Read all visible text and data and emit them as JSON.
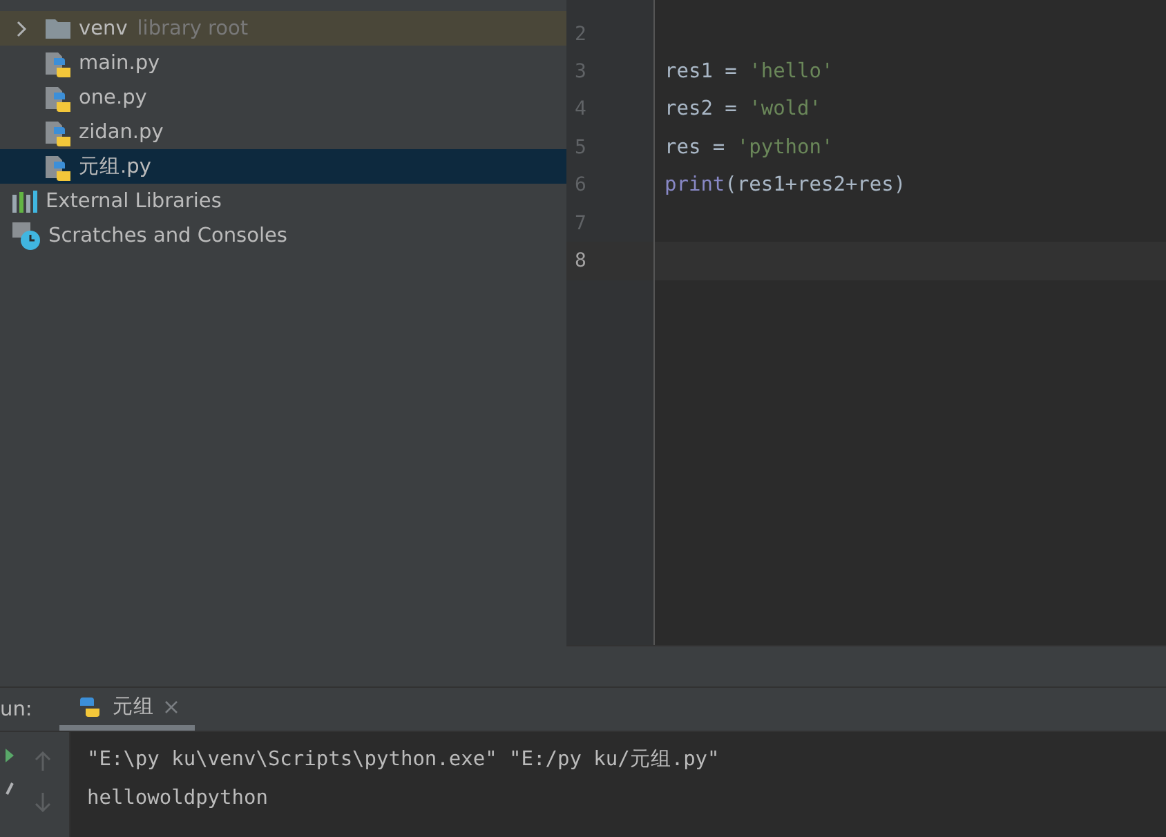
{
  "project_tree": {
    "items": [
      {
        "kind": "folder",
        "label": "venv",
        "hint": "library root",
        "expanded": false,
        "selected": false
      },
      {
        "kind": "python-file",
        "label": "main.py",
        "selected": false
      },
      {
        "kind": "python-file",
        "label": "one.py",
        "selected": false
      },
      {
        "kind": "python-file",
        "label": "zidan.py",
        "selected": false
      },
      {
        "kind": "python-file",
        "label": "元组.py",
        "selected": true
      },
      {
        "kind": "libraries",
        "label": "External Libraries",
        "selected": false
      },
      {
        "kind": "scratches",
        "label": "Scratches and Consoles",
        "selected": false
      }
    ]
  },
  "editor": {
    "lines": [
      {
        "number": "2",
        "current": false
      },
      {
        "number": "3",
        "current": false,
        "tokens": [
          {
            "kind": "name",
            "text": "res1 = "
          },
          {
            "kind": "string",
            "text": "'hello'"
          }
        ]
      },
      {
        "number": "4",
        "current": false,
        "tokens": [
          {
            "kind": "name",
            "text": "res2 = "
          },
          {
            "kind": "string",
            "text": "'wold'"
          }
        ]
      },
      {
        "number": "5",
        "current": false,
        "tokens": [
          {
            "kind": "name",
            "text": "res = "
          },
          {
            "kind": "string",
            "text": "'python'"
          }
        ]
      },
      {
        "number": "6",
        "current": false,
        "tokens": [
          {
            "kind": "builtin",
            "text": "print"
          },
          {
            "kind": "name",
            "text": "(res1+res2+res)"
          }
        ]
      },
      {
        "number": "7",
        "current": false
      },
      {
        "number": "8",
        "current": true
      }
    ]
  },
  "run_panel": {
    "label": "un:",
    "tabs": [
      {
        "label": "元组",
        "selected": true
      }
    ],
    "console": {
      "lines": [
        "\"E:\\py ku\\venv\\Scripts\\python.exe\" \"E:/py ku/元组.py\"",
        "hellowoldpython"
      ]
    }
  }
}
